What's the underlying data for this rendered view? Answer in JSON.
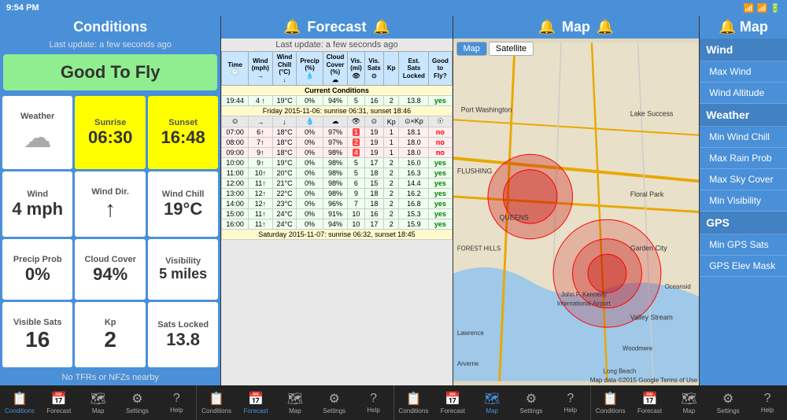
{
  "statusBar": {
    "time": "9:54 PM",
    "signals": "●●●●"
  },
  "panels": {
    "conditions": {
      "title": "Conditions",
      "lastUpdate": "Last update: a few seconds ago",
      "goodToFly": "Good To Fly",
      "cells": [
        {
          "label": "Weather",
          "value": "",
          "type": "cloud",
          "bg": "white"
        },
        {
          "label": "Sunrise",
          "value": "06:30",
          "type": "text",
          "bg": "yellow"
        },
        {
          "label": "Sunset",
          "value": "16:48",
          "type": "text",
          "bg": "yellow"
        },
        {
          "label": "Wind",
          "value": "4 mph",
          "type": "text",
          "bg": "white"
        },
        {
          "label": "Wind Dir.",
          "value": "↑",
          "type": "arrow",
          "bg": "white"
        },
        {
          "label": "Wind Chill",
          "value": "19°C",
          "type": "text",
          "bg": "white"
        },
        {
          "label": "Precip Prob",
          "value": "0%",
          "type": "text",
          "bg": "white"
        },
        {
          "label": "Cloud Cover",
          "value": "94%",
          "type": "text",
          "bg": "white"
        },
        {
          "label": "Visibility",
          "value": "5 miles",
          "type": "text",
          "bg": "white"
        },
        {
          "label": "Visible Sats",
          "value": "16",
          "type": "text",
          "bg": "white"
        },
        {
          "label": "Kp",
          "value": "2",
          "type": "text",
          "bg": "white"
        },
        {
          "label": "Sats Locked",
          "value": "13.8",
          "type": "text",
          "bg": "white"
        }
      ],
      "noTfr": "No TFRs or NFZs nearby"
    },
    "forecast": {
      "title": "Forecast",
      "lastUpdate": "Last update: a few seconds ago",
      "columns": [
        "Time",
        "Wind (mph)",
        "Wind Chill (°C)",
        "Precip (%)",
        "Cloud Cover (%)",
        "Visibility (miles)",
        "Visible Sats",
        "Kp",
        "Est. Sats Locked",
        "Good to Fly?"
      ],
      "colIcons": [
        "🕐",
        "→",
        "↓",
        "💧",
        "☁",
        "👁",
        "⊙",
        "Kp",
        "⊙×Kp",
        "☉"
      ],
      "currentConditions": {
        "label": "Current Conditions",
        "row": [
          "19:44",
          "4 ↑",
          "19°C",
          "0%",
          "94%",
          "5",
          "16",
          "2",
          "13.8",
          "yes"
        ]
      },
      "days": [
        {
          "label": "Friday 2015-11-06: sunrise 06:31, sunset 18:46",
          "rows": [
            {
              "time": "07:00",
              "wind": "6↑",
              "chill": "18°C",
              "precip": "0%",
              "cloud": "97%",
              "vis": "1",
              "sats": "19",
              "kp": "1",
              "est": "18.1",
              "fly": "no",
              "highlight": true
            },
            {
              "time": "08:00",
              "wind": "7↑",
              "chill": "18°C",
              "precip": "0%",
              "cloud": "97%",
              "vis": "2",
              "sats": "19",
              "kp": "1",
              "est": "18.0",
              "fly": "no",
              "highlight": true
            },
            {
              "time": "09:00",
              "wind": "9↑",
              "chill": "18°C",
              "precip": "0%",
              "cloud": "98%",
              "vis": "4",
              "sats": "19",
              "kp": "1",
              "est": "18.0",
              "fly": "no",
              "highlight": true
            },
            {
              "time": "10:00",
              "wind": "9↑",
              "chill": "19°C",
              "precip": "0%",
              "cloud": "98%",
              "vis": "5",
              "sats": "17",
              "kp": "2",
              "est": "16.0",
              "fly": "yes",
              "highlight": false
            },
            {
              "time": "11:00",
              "wind": "10↑",
              "chill": "20°C",
              "precip": "0%",
              "cloud": "98%",
              "vis": "5",
              "sats": "18",
              "kp": "2",
              "est": "16.3",
              "fly": "yes",
              "highlight": false
            },
            {
              "time": "12:00",
              "wind": "11↑",
              "chill": "21°C",
              "precip": "0%",
              "cloud": "98%",
              "vis": "6",
              "sats": "15",
              "kp": "2",
              "est": "14.4",
              "fly": "yes",
              "highlight": false
            },
            {
              "time": "13:00",
              "wind": "12↑",
              "chill": "22°C",
              "precip": "0%",
              "cloud": "98%",
              "vis": "9",
              "sats": "18",
              "kp": "2",
              "est": "16.2",
              "fly": "yes",
              "highlight": false
            },
            {
              "time": "14:00",
              "wind": "12↑",
              "chill": "23°C",
              "precip": "0%",
              "cloud": "96%",
              "vis": "7",
              "sats": "18",
              "kp": "2",
              "est": "16.8",
              "fly": "yes",
              "highlight": false
            },
            {
              "time": "15:00",
              "wind": "11↑",
              "chill": "24°C",
              "precip": "0%",
              "cloud": "91%",
              "vis": "10",
              "sats": "16",
              "kp": "2",
              "est": "15.3",
              "fly": "yes",
              "highlight": false
            },
            {
              "time": "16:00",
              "wind": "11↑",
              "chill": "24°C",
              "precip": "0%",
              "cloud": "94%",
              "vis": "10",
              "sats": "17",
              "kp": "2",
              "est": "15.9",
              "fly": "yes",
              "highlight": false
            }
          ]
        }
      ],
      "nextDay": "Saturday 2015-11-07: sunrise 06:32, sunset 18:45"
    },
    "map": {
      "title": "Map",
      "tabs": [
        "Map",
        "Satellite"
      ],
      "copyright": "Map data ©2015 Google  Terms of Use"
    },
    "rightSidebar": {
      "title": "Map",
      "items": [
        {
          "label": "Wind",
          "type": "section"
        },
        {
          "label": "Max Wind",
          "type": "sub"
        },
        {
          "label": "Wind Altitude",
          "type": "sub"
        },
        {
          "label": "Weather",
          "type": "section"
        },
        {
          "label": "Min Wind Chill",
          "type": "sub"
        },
        {
          "label": "Max Rain Prob",
          "type": "sub"
        },
        {
          "label": "Max Sky Cover",
          "type": "sub"
        },
        {
          "label": "Min Visibility",
          "type": "sub"
        },
        {
          "label": "GPS",
          "type": "section"
        },
        {
          "label": "Min GPS Sats",
          "type": "sub"
        },
        {
          "label": "GPS Elev Mask",
          "type": "sub"
        }
      ]
    }
  },
  "bottomNav": {
    "sections": [
      {
        "items": [
          {
            "label": "Conditions",
            "icon": "📋",
            "active": true
          },
          {
            "label": "Forecast",
            "icon": "📅",
            "active": false
          },
          {
            "label": "Map",
            "icon": "🗺",
            "active": false
          },
          {
            "label": "Settings",
            "icon": "⚙",
            "active": false
          },
          {
            "label": "Help",
            "icon": "?",
            "active": false
          }
        ]
      },
      {
        "items": [
          {
            "label": "Conditions",
            "icon": "📋",
            "active": false
          },
          {
            "label": "Forecast",
            "icon": "📅",
            "active": true
          },
          {
            "label": "Map",
            "icon": "🗺",
            "active": false
          },
          {
            "label": "Settings",
            "icon": "⚙",
            "active": false
          },
          {
            "label": "Help",
            "icon": "?",
            "active": false
          }
        ]
      },
      {
        "items": [
          {
            "label": "Conditions",
            "icon": "📋",
            "active": false
          },
          {
            "label": "Forecast",
            "icon": "📅",
            "active": false
          },
          {
            "label": "Map",
            "icon": "🗺",
            "active": true
          },
          {
            "label": "Settings",
            "icon": "⚙",
            "active": false
          },
          {
            "label": "Help",
            "icon": "?",
            "active": false
          }
        ]
      },
      {
        "items": [
          {
            "label": "Conditions",
            "icon": "📋",
            "active": false
          },
          {
            "label": "Forecast",
            "icon": "📅",
            "active": false
          },
          {
            "label": "Map",
            "icon": "🗺",
            "active": false
          },
          {
            "label": "Settings",
            "icon": "⚙",
            "active": false
          },
          {
            "label": "Help",
            "icon": "?",
            "active": false
          }
        ]
      }
    ]
  }
}
